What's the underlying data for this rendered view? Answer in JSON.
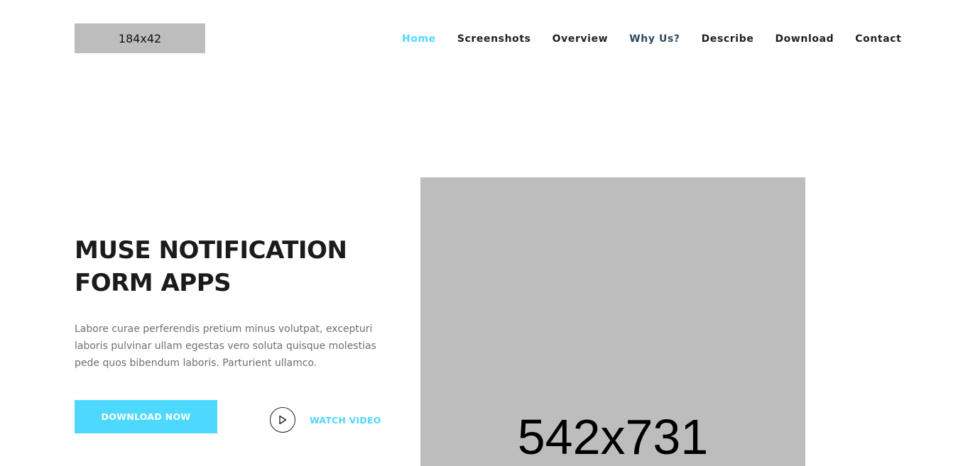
{
  "header": {
    "logo_text": "184x42",
    "nav": {
      "home": "Home",
      "screenshots": "Screenshots",
      "overview": "Overview",
      "why_us": "Why Us?",
      "describe": "Describe",
      "download": "Download",
      "contact": "Contact"
    },
    "active_item": "Home"
  },
  "hero": {
    "title": "MUSE NOTIFICATION FORM APPS",
    "description": "Labore curae perferendis pretium minus volutpat, excepturi laboris pulvinar ullam egestas vero soluta quisque molestias pede quos bibendum laboris. Parturient ullamco.",
    "download_button": "DOWNLOAD NOW",
    "watch_video": "WATCH VIDEO",
    "play_icon": "play-icon",
    "image_label": "542x731"
  },
  "colors": {
    "accent": "#4dd9ff",
    "text_dark": "#1b1b1b",
    "text_muted": "#6f6f6f",
    "placeholder": "#bdbdbd"
  }
}
